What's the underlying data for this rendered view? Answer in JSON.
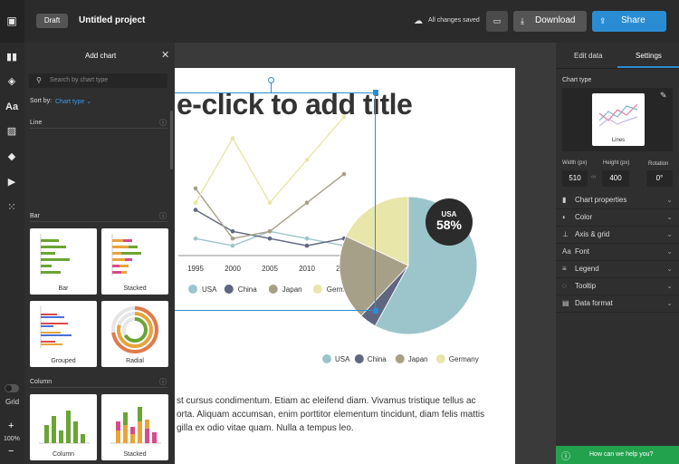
{
  "topbar": {
    "draft_label": "Draft",
    "project_title": "Untitled project",
    "save_status": "All changes saved",
    "download_label": "Download",
    "share_label": "Share"
  },
  "add_chart_panel": {
    "title": "Add chart",
    "search_placeholder": "Search by chart type",
    "sort_label": "Sort by:",
    "sort_value": "Chart type",
    "sections": [
      {
        "name": "Line",
        "items": []
      },
      {
        "name": "Bar",
        "items": [
          "Bar",
          "Stacked",
          "Grouped",
          "Radial"
        ]
      },
      {
        "name": "Column",
        "items": [
          "Column",
          "Stacked"
        ]
      }
    ]
  },
  "left_rail": {
    "grid_label": "Grid",
    "zoom_plus": "+",
    "zoom_value": "100%",
    "zoom_minus": "−"
  },
  "canvas": {
    "title_placeholder": "e-click to add title",
    "body_lines": [
      "st cursus condimentum. Etiam ac eleifend diam. Vivamus tristique tellus ac",
      "orta. Aliquam accumsan, enim porttitor elementum tincidunt, diam felis mattis",
      "gilla ex odio vitae quam. Nulla a tempus leo."
    ],
    "pie_badge_label": "USA",
    "pie_badge_value": "58%"
  },
  "chart_data": [
    {
      "type": "line",
      "x": [
        1995,
        2000,
        2005,
        2010,
        2015
      ],
      "series": [
        {
          "name": "USA",
          "color": "#9cc5cb",
          "values": [
            2,
            1,
            3,
            2,
            1
          ]
        },
        {
          "name": "China",
          "color": "#5f6780",
          "values": [
            6,
            3,
            2,
            1,
            2
          ]
        },
        {
          "name": "Japan",
          "color": "#a7a089",
          "values": [
            9,
            2,
            3,
            7,
            11
          ]
        },
        {
          "name": "Germany",
          "color": "#e8e6a9",
          "values": [
            7,
            16,
            7,
            13,
            19
          ]
        }
      ],
      "legend": "bottom"
    },
    {
      "type": "pie",
      "categories": [
        "USA",
        "China",
        "Japan",
        "Germany"
      ],
      "values": [
        58,
        4,
        20,
        18
      ],
      "colors": [
        "#9cc5cb",
        "#5f6780",
        "#a7a089",
        "#e8e6a9"
      ],
      "legend": "bottom"
    }
  ],
  "right_panel": {
    "tab_edit": "Edit data",
    "tab_settings": "Settings",
    "chart_type_label": "Chart type",
    "chart_type_value": "Lines",
    "width_label": "Width (px)",
    "width_value": "510",
    "height_label": "Height (px)",
    "height_value": "400",
    "rotation_label": "Rotation",
    "rotation_value": "0°",
    "sections": [
      "Chart properties",
      "Color",
      "Axis & grid",
      "Font",
      "Legend",
      "Tooltip",
      "Data format"
    ],
    "help_label": "How can we help you?"
  },
  "colors": {
    "accent": "#2a8dd4",
    "help_green": "#23a24d",
    "dark_bg": "#2b2b2b"
  }
}
